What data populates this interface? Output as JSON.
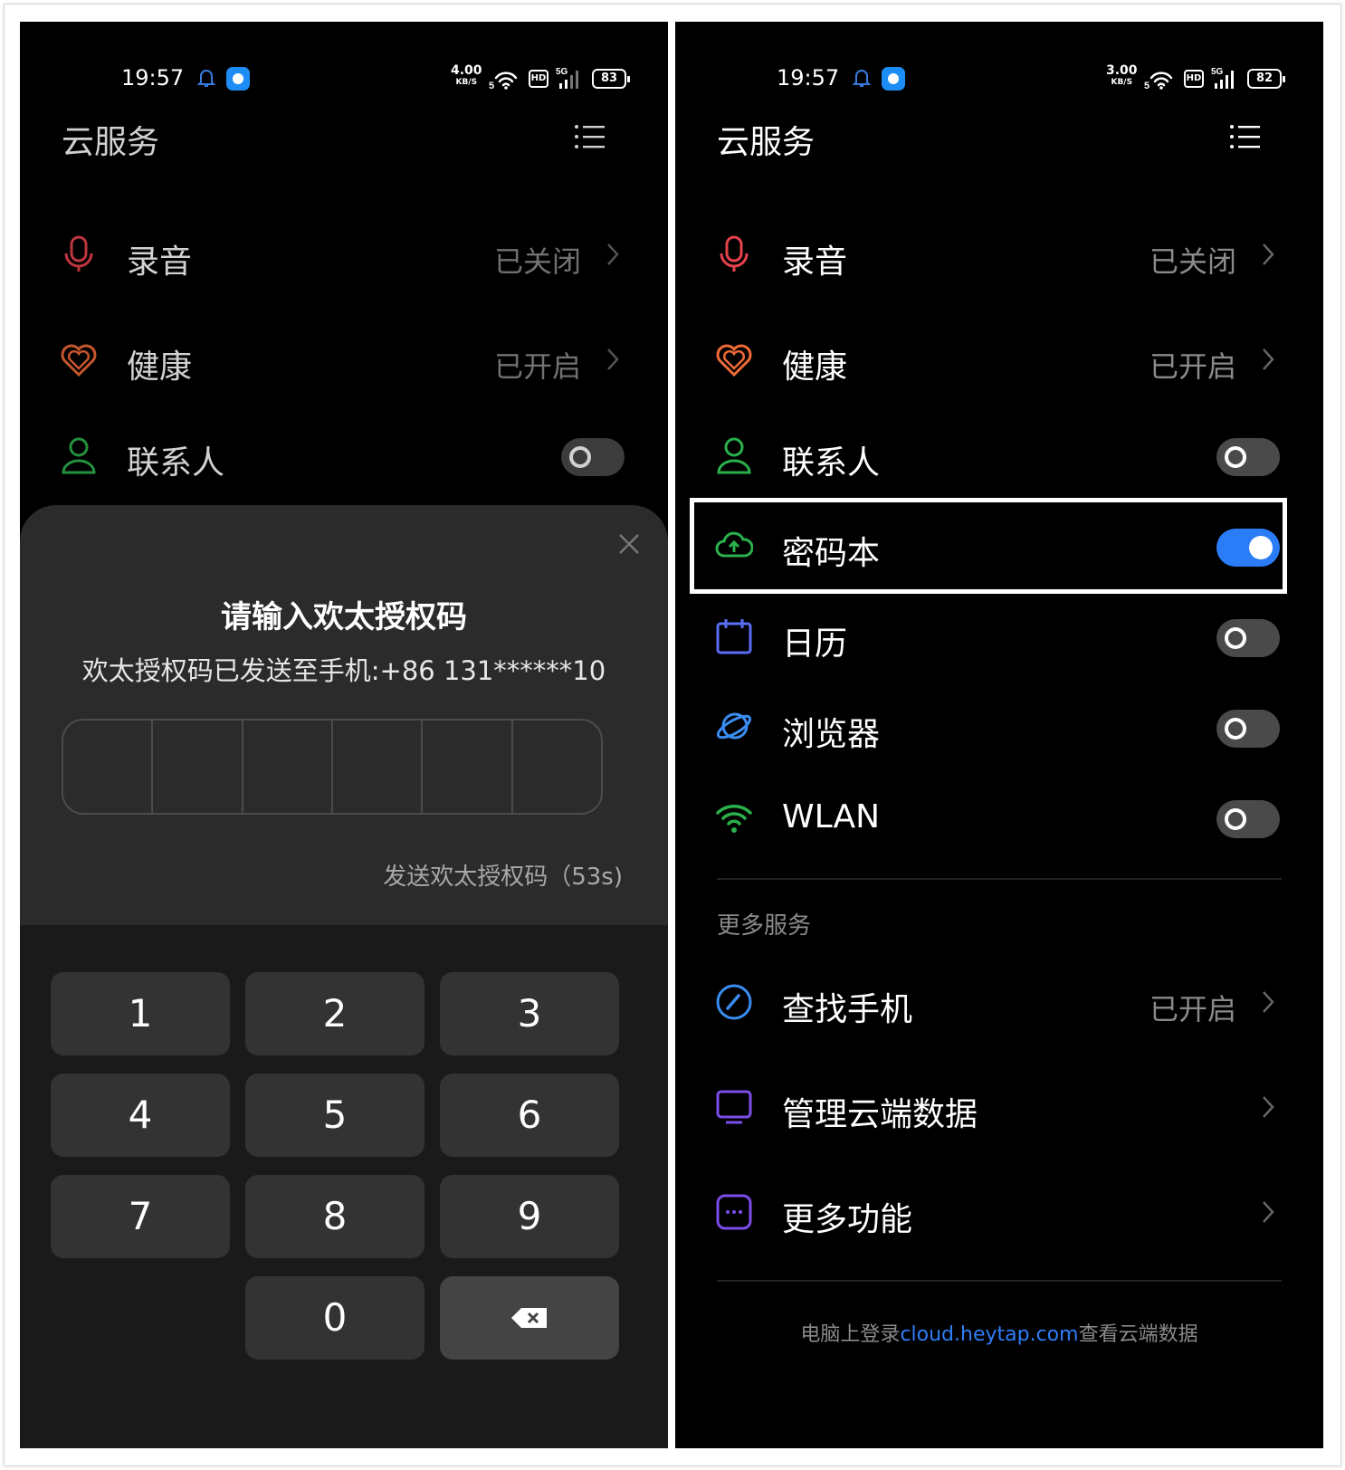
{
  "left": {
    "status": {
      "time": "19:57",
      "speed": "4.00",
      "speed_unit": "KB/S",
      "battery": "83",
      "network": "5G",
      "hd": "HD"
    },
    "header": {
      "title": "云服务"
    },
    "rows": [
      {
        "label": "录音",
        "status": "已关闭"
      },
      {
        "label": "健康",
        "status": "已开启"
      },
      {
        "label": "联系人"
      }
    ],
    "dialog": {
      "title": "请输入欢太授权码",
      "subtitle": "欢太授权码已发送至手机:+86 131******10",
      "resend": "发送欢太授权码（53s)"
    },
    "keypad": [
      "1",
      "2",
      "3",
      "4",
      "5",
      "6",
      "7",
      "8",
      "9",
      "0"
    ]
  },
  "right": {
    "status": {
      "time": "19:57",
      "speed": "3.00",
      "speed_unit": "KB/S",
      "battery": "82",
      "network": "5G",
      "hd": "HD"
    },
    "header": {
      "title": "云服务"
    },
    "rows": [
      {
        "label": "录音",
        "status": "已关闭"
      },
      {
        "label": "健康",
        "status": "已开启"
      },
      {
        "label": "联系人",
        "toggle": false
      },
      {
        "label": "密码本",
        "toggle": true
      },
      {
        "label": "日历",
        "toggle": false
      },
      {
        "label": "浏览器",
        "toggle": false
      },
      {
        "label": "WLAN",
        "toggle": false
      }
    ],
    "more_section": {
      "header": "更多服务",
      "items": [
        {
          "label": "查找手机",
          "status": "已开启"
        },
        {
          "label": "管理云端数据"
        },
        {
          "label": "更多功能"
        }
      ]
    },
    "footer": {
      "prefix": "电脑上登录",
      "link": "cloud.heytap.com",
      "suffix": "查看云端数据"
    }
  },
  "colors": {
    "accent": "#2a7df6",
    "background": "#000000",
    "sheet": "#2b2b2b",
    "secondary_text": "#8a8a8a"
  },
  "icons": [
    "bell-icon",
    "app-icon",
    "wifi-icon",
    "signal-icon",
    "battery-icon",
    "menu-list-icon",
    "microphone-icon",
    "heart-icon",
    "contact-icon",
    "cloud-icon",
    "calendar-icon",
    "browser-planet-icon",
    "wlan-icon",
    "compass-icon",
    "monitor-icon",
    "more-dots-icon",
    "chevron-right-icon",
    "close-icon",
    "backspace-icon"
  ]
}
